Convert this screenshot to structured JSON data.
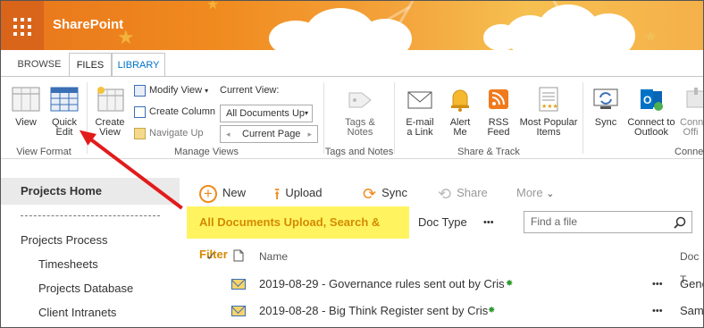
{
  "suite": {
    "brand": "SharePoint"
  },
  "tabs": [
    {
      "label": "BROWSE"
    },
    {
      "label": "FILES"
    },
    {
      "label": "LIBRARY"
    }
  ],
  "ribbon": {
    "view_format": {
      "label": "View Format",
      "view": "View",
      "quick_edit": "Quick Edit"
    },
    "manage_views": {
      "label": "Manage Views",
      "create_view": "Create View",
      "modify_view": "Modify View",
      "create_column": "Create Column",
      "navigate_up": "Navigate Up",
      "current_view_label": "Current View:",
      "current_view_value": "All Documents Up",
      "current_page": "Current Page"
    },
    "tags_notes": {
      "label": "Tags and Notes",
      "tags_notes": "Tags & Notes"
    },
    "share_track": {
      "label": "Share & Track",
      "email_link": "E-mail a Link",
      "alert_me": "Alert Me",
      "rss_feed": "RSS Feed",
      "most_popular": "Most Popular Items"
    },
    "connect": {
      "label": "Conne",
      "sync": "Sync",
      "connect_outlook": "Connect to Outlook",
      "connect_office": "Conn Offi"
    }
  },
  "leftnav": {
    "home": "Projects Home",
    "items": [
      {
        "label": "Projects Process"
      },
      {
        "label": "Timesheets"
      },
      {
        "label": "Projects Database"
      },
      {
        "label": "Client Intranets"
      }
    ]
  },
  "commands": {
    "new": "New",
    "upload": "Upload",
    "sync": "Sync",
    "share": "Share",
    "more": "More"
  },
  "views": {
    "highlighted": "All Documents Upload, Search & Filter",
    "doc_type": "Doc Type",
    "overflow": "•••"
  },
  "search": {
    "placeholder": "Find a file"
  },
  "list": {
    "headers": {
      "name": "Name",
      "doc_type": "Doc T"
    },
    "rows": [
      {
        "name": "2019-08-29 - Governance rules sent out by Cris",
        "doc_type": "Gene",
        "more": "•••"
      },
      {
        "name": "2019-08-28 - Big Think Register sent by Cris",
        "doc_type": "Sam",
        "more": "•••"
      }
    ]
  },
  "colors": {
    "accent": "#0072c6",
    "suite_orange": "#f08a1e",
    "highlight": "#fff460",
    "arrow": "#e21b1b"
  }
}
